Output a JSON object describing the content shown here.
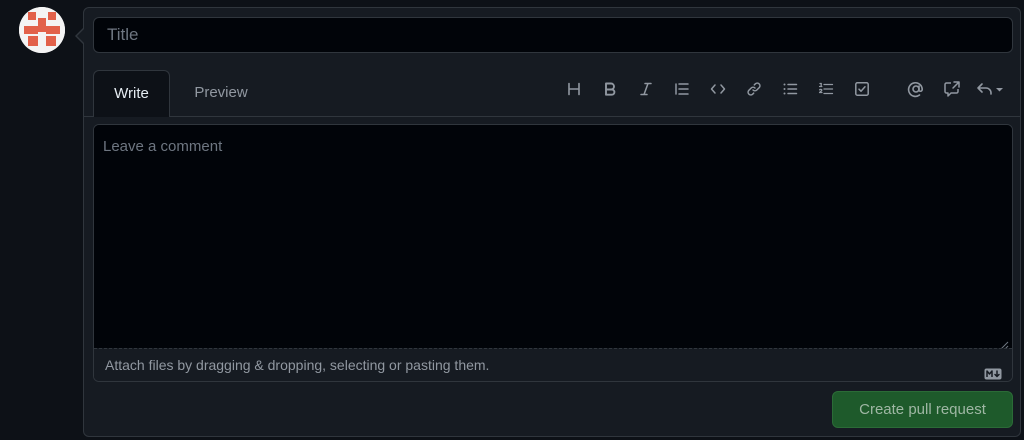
{
  "form": {
    "title_placeholder": "Title",
    "title_value": ""
  },
  "tabs": [
    {
      "label": "Write",
      "active": true
    },
    {
      "label": "Preview",
      "active": false
    }
  ],
  "toolbar": {
    "icons": [
      "heading-icon",
      "bold-icon",
      "italic-icon",
      "quote-icon",
      "code-icon",
      "link-icon",
      "unordered-list-icon",
      "ordered-list-icon",
      "task-list-icon",
      "mention-icon",
      "cross-reference-icon",
      "reply-icon"
    ]
  },
  "editor": {
    "placeholder": "Leave a comment",
    "value": "",
    "attach_hint": "Attach files by dragging & dropping, selecting or pasting them.",
    "markdown_icon": "markdown-icon"
  },
  "actions": {
    "create_label": "Create pull request"
  },
  "colors": {
    "background": "#0d1117",
    "panel": "#161b22",
    "border": "#30363d",
    "input_bg": "#010409",
    "muted_text": "#9198a1",
    "button_bg": "#1e5a2b",
    "avatar_accent": "#e2614a"
  }
}
